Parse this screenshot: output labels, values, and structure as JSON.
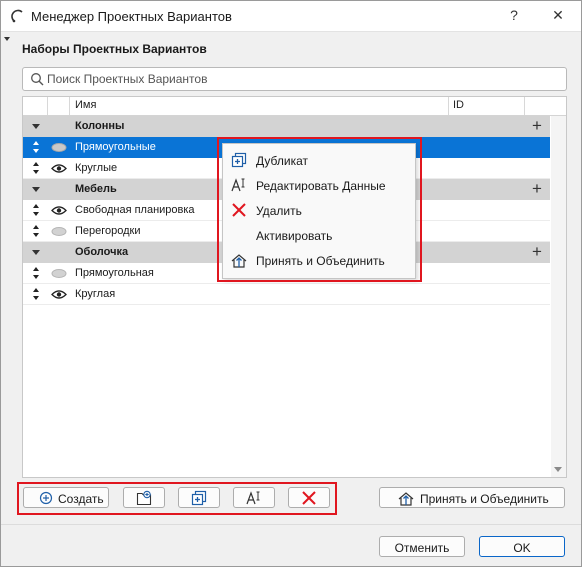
{
  "window": {
    "title": "Менеджер Проектных Вариантов",
    "help": "?",
    "close": "✕"
  },
  "section_title": "Наборы Проектных Вариантов",
  "search": {
    "placeholder": "Поиск Проектных Вариантов"
  },
  "table": {
    "columns": [
      "Имя",
      "ID"
    ],
    "groups": [
      {
        "label": "Колонны",
        "add": "+",
        "items": [
          {
            "label": "Прямоугольные",
            "selected": true,
            "visible": false
          },
          {
            "label": "Круглые",
            "selected": false,
            "visible": true
          }
        ]
      },
      {
        "label": "Мебель",
        "add": "+",
        "items": [
          {
            "label": "Свободная планировка",
            "selected": false,
            "visible": true
          },
          {
            "label": "Перегородки",
            "selected": false,
            "visible": false
          }
        ]
      },
      {
        "label": "Оболочка",
        "add": "+",
        "items": [
          {
            "label": "Прямоугольная",
            "selected": false,
            "visible": false
          },
          {
            "label": "Круглая",
            "selected": false,
            "visible": true
          }
        ]
      }
    ]
  },
  "context_menu": {
    "items": [
      {
        "label": "Дубликат",
        "icon": "duplicate-icon"
      },
      {
        "label": "Редактировать Данные",
        "icon": "edit-data-icon"
      },
      {
        "label": "Удалить",
        "icon": "delete-x-icon"
      },
      {
        "label": "Активировать",
        "icon": ""
      },
      {
        "label": "Принять и Объединить",
        "icon": "accept-merge-icon"
      }
    ]
  },
  "toolbar": {
    "create_label": "Создать",
    "accept_merge_label": "Принять и Объединить"
  },
  "footer": {
    "cancel_label": "Отменить",
    "ok_label": "OK"
  },
  "colors": {
    "selection": "#0a74d6",
    "highlight_box": "#e0161f",
    "delete_red": "#e0161f",
    "primary_border": "#0a66c8"
  }
}
